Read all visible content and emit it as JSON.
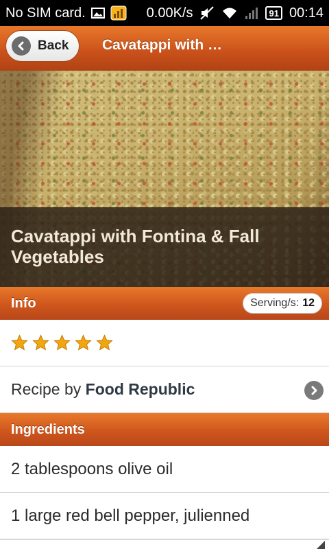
{
  "status_bar": {
    "carrier": "No SIM card.",
    "speed": "0.00K/s",
    "battery": "91",
    "time": "00:14",
    "icons": [
      "image-icon",
      "signal-app-icon",
      "mute-icon",
      "wifi-icon",
      "cell-signal-icon",
      "battery-icon"
    ]
  },
  "header": {
    "back_label": "Back",
    "title": "Cavatappi with …"
  },
  "hero": {
    "title": "Cavatappi with Fontina & Fall Vegetables"
  },
  "info": {
    "label": "Info",
    "servings_label": "Serving/s:",
    "servings_value": "12",
    "rating": 5,
    "recipe_by_prefix": "Recipe by",
    "recipe_source": "Food Republic"
  },
  "ingredients": {
    "label": "Ingredients",
    "items": [
      "2 tablespoons olive oil",
      "1 large red bell pepper, julienned"
    ]
  },
  "colors": {
    "accent": "#d4581e",
    "star": "#f2a60f"
  }
}
